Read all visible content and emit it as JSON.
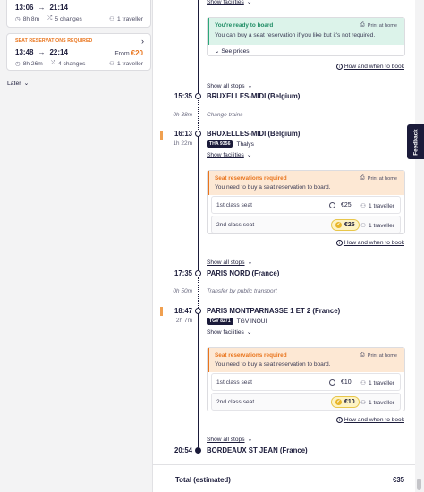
{
  "journeys": [
    {
      "depart": "13:06",
      "arrive": "21:14",
      "duration": "8h 8m",
      "changes": "5 changes",
      "travellers": "1 traveller"
    },
    {
      "tag": "SEAT RESERVATIONS REQUIRED",
      "depart": "13:48",
      "arrive": "22:14",
      "duration": "8h 26m",
      "changes": "4 changes",
      "travellers": "1 traveller",
      "from_label": "From",
      "price": "€20"
    }
  ],
  "later_label": "Later",
  "itinerary": {
    "show_facilities": "Show facilities",
    "show_all_stops": "Show all stops",
    "how_link": "How and when to book",
    "ready_box": {
      "title": "You're ready to board",
      "text": "You can buy a seat reservation if you like but it's not required.",
      "print": "Print at home",
      "see_prices": "See prices"
    },
    "stop1": {
      "time": "15:35",
      "station": "BRUXELLES-MIDI (Belgium)"
    },
    "transfer1": {
      "duration": "0h 38m",
      "text": "Change trains"
    },
    "stop2": {
      "time": "16:13",
      "station": "BRUXELLES-MIDI (Belgium)",
      "leg_duration": "1h 22m",
      "train_badge": "THA 9356",
      "train_name": "Thalys"
    },
    "seat_box1": {
      "title": "Seat reservations required",
      "text": "You need to buy a seat reservation to board.",
      "print": "Print at home",
      "rows": [
        {
          "class": "1st class seat",
          "price": "€25",
          "travellers": "1 traveller",
          "selected": false
        },
        {
          "class": "2nd class seat",
          "price": "€25",
          "travellers": "1 traveller",
          "selected": true
        }
      ]
    },
    "stop3": {
      "time": "17:35",
      "station": "PARIS NORD (France)"
    },
    "transfer2": {
      "duration": "0h 50m",
      "text": "Transfer by public transport"
    },
    "stop4": {
      "time": "18:47",
      "station": "PARIS MONTPARNASSE 1 ET 2 (France)",
      "leg_duration": "2h 7m",
      "train_badge": "TGV 8271",
      "train_name": "TGV INOUI"
    },
    "seat_box2": {
      "title": "Seat reservations required",
      "text": "You need to buy a seat reservation to board.",
      "print": "Print at home",
      "rows": [
        {
          "class": "1st class seat",
          "price": "€10",
          "travellers": "1 traveller",
          "selected": false
        },
        {
          "class": "2nd class seat",
          "price": "€10",
          "travellers": "1 traveller",
          "selected": true
        }
      ]
    },
    "stop5": {
      "time": "20:54",
      "station": "BORDEAUX ST JEAN (France)"
    }
  },
  "total": {
    "label": "Total (estimated)",
    "price": "€35"
  },
  "feedback_label": "Feedback",
  "colors": {
    "accent_orange": "#e9741c",
    "navy": "#1b1b3a",
    "green": "#2da77a",
    "yellow": "#e8b62a"
  }
}
